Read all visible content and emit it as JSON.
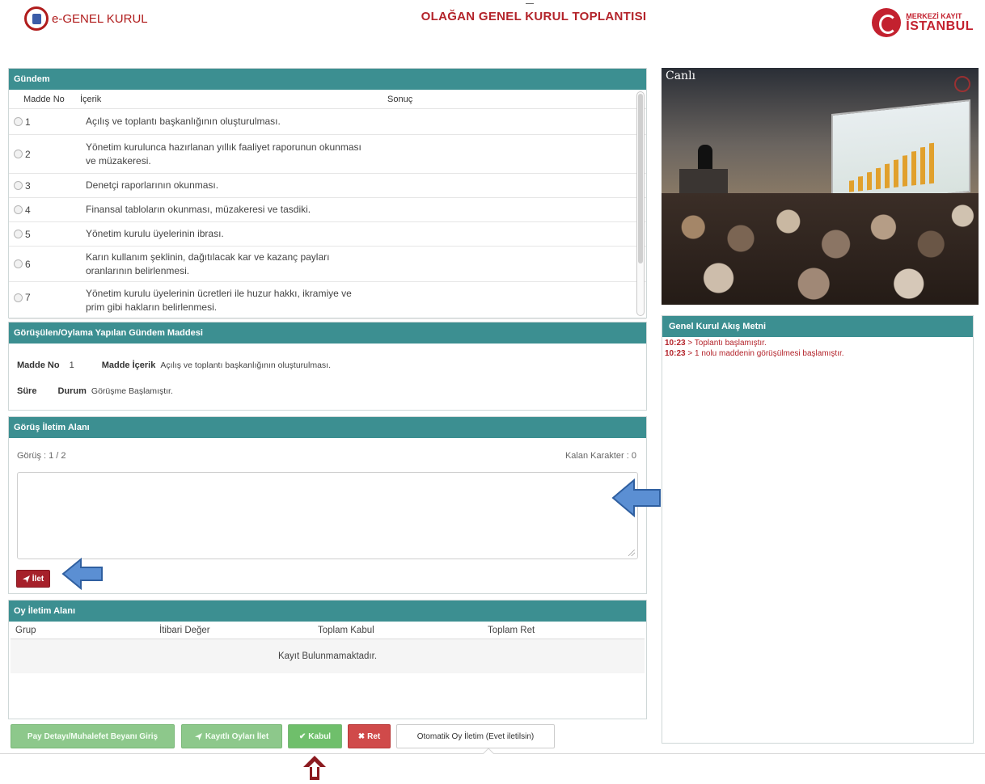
{
  "header": {
    "logo_left_text": "e-GENEL KURUL",
    "title": "OLAĞAN GENEL KURUL TOPLANTISI",
    "logo_right_top": "MERKEZİ KAYIT",
    "logo_right_bottom": "İSTANBUL"
  },
  "gundem": {
    "title": "Gündem",
    "columns": [
      "Madde No",
      "İçerik",
      "Sonuç"
    ],
    "rows": [
      {
        "no": "1",
        "text": "Açılış ve toplantı başkanlığının oluşturulması."
      },
      {
        "no": "2",
        "text": "Yönetim kurulunca hazırlanan yıllık faaliyet raporunun okunması ve müzakeresi."
      },
      {
        "no": "3",
        "text": "Denetçi raporlarının okunması."
      },
      {
        "no": "4",
        "text": "Finansal tabloların okunması, müzakeresi ve tasdiki."
      },
      {
        "no": "5",
        "text": "Yönetim kurulu üyelerinin ibrası."
      },
      {
        "no": "6",
        "text": "Karın kullanım şeklinin, dağıtılacak kar ve kazanç payları oranlarının belirlenmesi."
      },
      {
        "no": "7",
        "text": "Yönetim kurulu üyelerinin ücretleri ile huzur hakkı, ikramiye ve prim gibi hakların belirlenmesi."
      }
    ]
  },
  "video": {
    "label": "Canlı"
  },
  "gorusulen": {
    "title": "Görüşülen/Oylama Yapılan Gündem Maddesi",
    "madde_no_label": "Madde No",
    "madde_no_value": "1",
    "madde_icerik_label": "Madde İçerik",
    "madde_icerik_value": "Açılış ve toplantı başkanlığının oluşturulması.",
    "sure_label": "Süre",
    "durum_label": "Durum",
    "durum_value": "Görüşme Başlamıştır."
  },
  "gorus": {
    "title": "Görüş İletim Alanı",
    "counter": "Görüş : 1 / 2",
    "remaining": "Kalan Karakter : 0",
    "textarea_value": "",
    "send_label": "İlet"
  },
  "oy": {
    "title": "Oy İletim Alanı",
    "columns": [
      "Grup",
      "İtibari Değer",
      "Toplam Kabul",
      "Toplam Ret"
    ],
    "empty_text": "Kayıt Bulunmamaktadır."
  },
  "akis": {
    "title": "Genel Kurul Akış Metni",
    "entries": [
      {
        "time": "10:23",
        "text": " > Toplantı başlamıştır."
      },
      {
        "time": "10:23",
        "text": " > 1 nolu maddenin görüşülmesi başlamıştır."
      }
    ]
  },
  "buttons": {
    "pay_detay": "Pay Detayı/Muhalefet Beyanı Giriş",
    "kayitli_oy": "Kayıtlı Oyları İlet",
    "kabul": "Kabul",
    "ret": "Ret",
    "otomatik": "Otomatik Oy İletim (Evet iletilsin)"
  },
  "colors": {
    "panel_header": "#3c8f91",
    "brand_red": "#b3232a",
    "annotation_arrow": "#5b8fd3",
    "annotation_up_arrow": "#8b1a1f"
  }
}
